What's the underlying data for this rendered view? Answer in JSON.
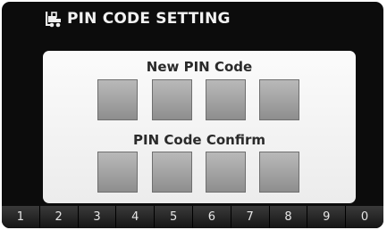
{
  "header": {
    "title": "PIN CODE SETTING",
    "icon": "forklift-icon"
  },
  "panel": {
    "new_label": "New PIN Code",
    "confirm_label": "PIN Code Confirm",
    "new_digits": [
      "",
      "",
      "",
      ""
    ],
    "confirm_digits": [
      "",
      "",
      "",
      ""
    ]
  },
  "keypad": {
    "keys": [
      "1",
      "2",
      "3",
      "4",
      "5",
      "6",
      "7",
      "8",
      "9",
      "0"
    ]
  },
  "colors": {
    "background": "#0c0c0c",
    "panel": "#f4f4f4",
    "pin_box": "#a4a4a4",
    "text_light": "#f2f2f2",
    "text_dark": "#2a2a2a"
  }
}
